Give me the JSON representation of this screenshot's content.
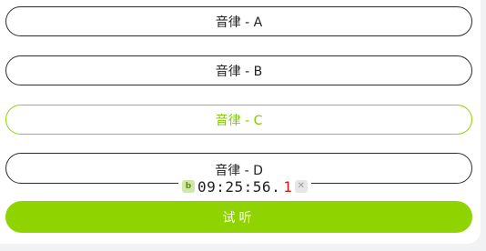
{
  "options": [
    {
      "label": "音律 - A",
      "selected": false
    },
    {
      "label": "音律 - B",
      "selected": false
    },
    {
      "label": "音律 - C",
      "selected": true
    },
    {
      "label": "音律 - D",
      "selected": false
    }
  ],
  "timer": {
    "main": "09:25:56.",
    "ms": "1",
    "icon_left": "leaf-icon",
    "icon_right": "close-icon"
  },
  "action": {
    "listen_label": "试听"
  },
  "colors": {
    "accent": "#8fd400",
    "selected_text": "#7fcc00",
    "ms_red": "#d11a1a",
    "border": "#2b2b2b"
  }
}
